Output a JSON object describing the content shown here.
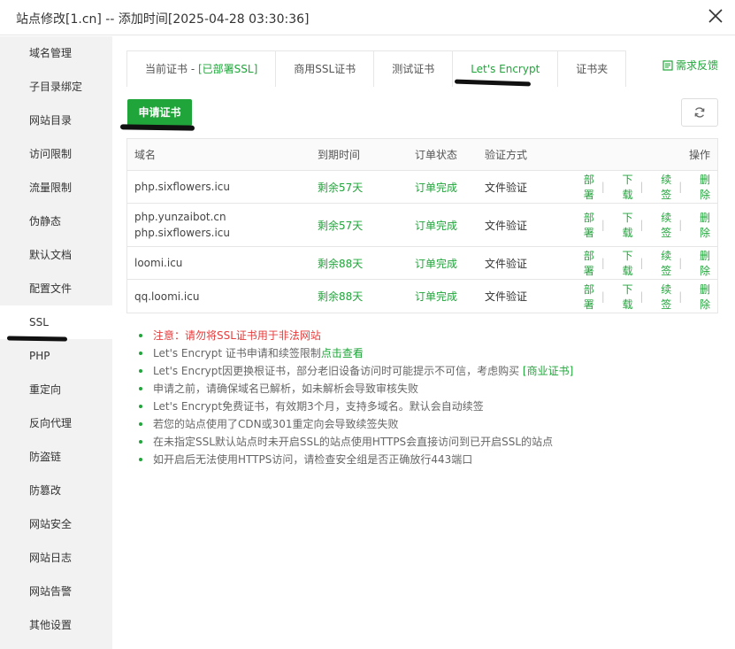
{
  "window": {
    "title": "站点修改[1.cn] -- 添加时间[2025-04-28 03:30:36]"
  },
  "sidebar": {
    "items": [
      {
        "label": "域名管理"
      },
      {
        "label": "子目录绑定"
      },
      {
        "label": "网站目录"
      },
      {
        "label": "访问限制"
      },
      {
        "label": "流量限制"
      },
      {
        "label": "伪静态"
      },
      {
        "label": "默认文档"
      },
      {
        "label": "配置文件"
      },
      {
        "label": "SSL"
      },
      {
        "label": "PHP"
      },
      {
        "label": "重定向"
      },
      {
        "label": "反向代理"
      },
      {
        "label": "防盗链"
      },
      {
        "label": "防篡改"
      },
      {
        "label": "网站安全"
      },
      {
        "label": "网站日志"
      },
      {
        "label": "网站告警"
      },
      {
        "label": "其他设置"
      }
    ],
    "active": "SSL"
  },
  "tabs": {
    "current_prefix": "当前证书 - ",
    "current_status": "[已部署SSL]",
    "commercial": "商用SSL证书",
    "test": "测试证书",
    "letsencrypt": "Let's Encrypt",
    "folder": "证书夹",
    "active": "Let's Encrypt"
  },
  "feedback_label": "需求反馈",
  "apply_button": "申请证书",
  "table": {
    "headers": {
      "domain": "域名",
      "expire": "到期时间",
      "status": "订单状态",
      "verify": "验证方式",
      "ops": "操作"
    },
    "rows": [
      {
        "domain1": "php.sixflowers.icu",
        "domain2": "",
        "expire": "剩余57天",
        "status": "订单完成",
        "verify": "文件验证"
      },
      {
        "domain1": "php.yunzaibot.cn",
        "domain2": "php.sixflowers.icu",
        "expire": "剩余57天",
        "status": "订单完成",
        "verify": "文件验证"
      },
      {
        "domain1": "loomi.icu",
        "domain2": "",
        "expire": "剩余88天",
        "status": "订单完成",
        "verify": "文件验证"
      },
      {
        "domain1": "qq.loomi.icu",
        "domain2": "",
        "expire": "剩余88天",
        "status": "订单完成",
        "verify": "文件验证"
      }
    ],
    "ops": {
      "deploy": "部署",
      "download": "下载",
      "renew": "续签",
      "delete": "删除",
      "separator": "|"
    }
  },
  "notes": {
    "n1": "注意：请勿将SSL证书用于非法网站",
    "n2_text": "Let's Encrypt 证书申请和续签限制",
    "n2_link": "点击查看",
    "n3_text": "Let's Encrypt因更换根证书，部分老旧设备访问时可能提示不可信，考虑购买 ",
    "n3_link": "[商业证书]",
    "n4": "申请之前，请确保域名已解析，如未解析会导致审核失败",
    "n5": "Let's Encrypt免费证书，有效期3个月，支持多域名。默认会自动续签",
    "n6": "若您的站点使用了CDN或301重定向会导致续签失败",
    "n7": "在未指定SSL默认站点时未开启SSL的站点使用HTTPS会直接访问到已开启SSL的站点",
    "n8": "如开启后无法使用HTTPS访问，请检查安全组是否正确放行443端口"
  },
  "colors": {
    "accent": "#20a53a",
    "warning": "#e53c3c",
    "sidebar_bg": "#f2f2f2"
  }
}
